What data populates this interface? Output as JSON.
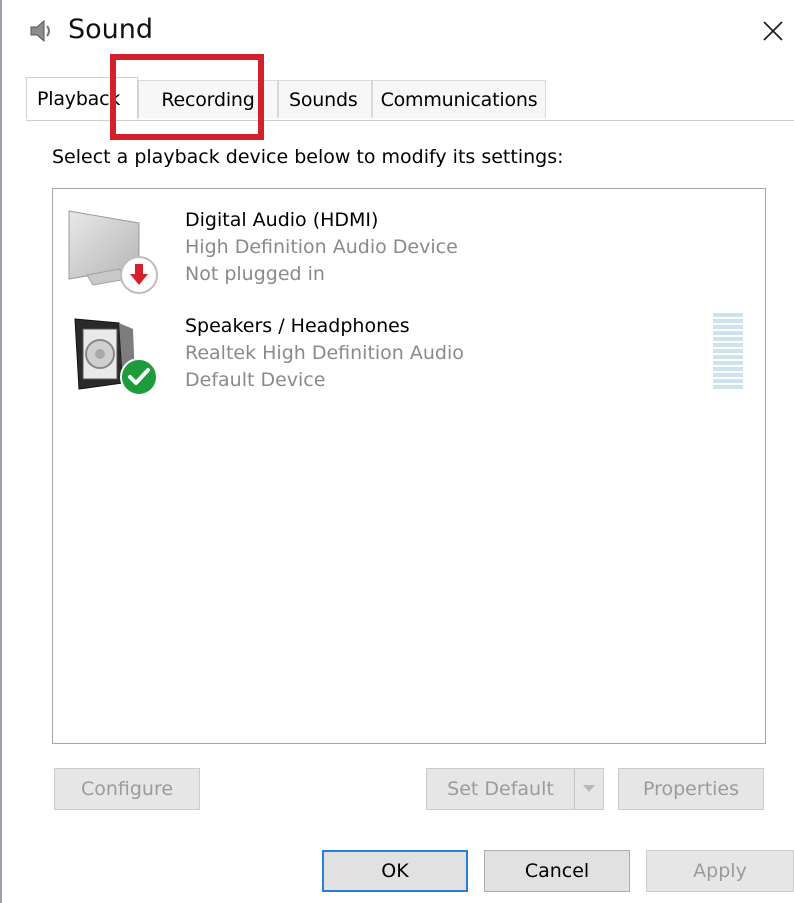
{
  "window": {
    "title": "Sound",
    "title_icon": "speaker-icon",
    "close_glyph": "✕"
  },
  "tabs": [
    {
      "label": "Playback",
      "active": true
    },
    {
      "label": "Recording",
      "active": false
    },
    {
      "label": "Sounds",
      "active": false
    },
    {
      "label": "Communications",
      "active": false
    }
  ],
  "instruction": "Select a playback device below to modify its settings:",
  "devices": [
    {
      "name": "Digital Audio (HDMI)",
      "description": "High Definition Audio Device",
      "status": "Not plugged in",
      "icon": "monitor-icon",
      "badge": "unplugged-arrow-icon"
    },
    {
      "name": "Speakers / Headphones",
      "description": "Realtek High Definition Audio",
      "status": "Default Device",
      "icon": "speaker-device-icon",
      "badge": "default-check-icon"
    }
  ],
  "buttons": {
    "configure": "Configure",
    "set_default": "Set Default",
    "properties": "Properties",
    "ok": "OK",
    "cancel": "Cancel",
    "apply": "Apply"
  },
  "colors": {
    "highlight": "#d4202b",
    "default_badge": "#1e9b3a",
    "unplugged_badge": "#d6202b",
    "focus_border": "#2a7fd4"
  }
}
